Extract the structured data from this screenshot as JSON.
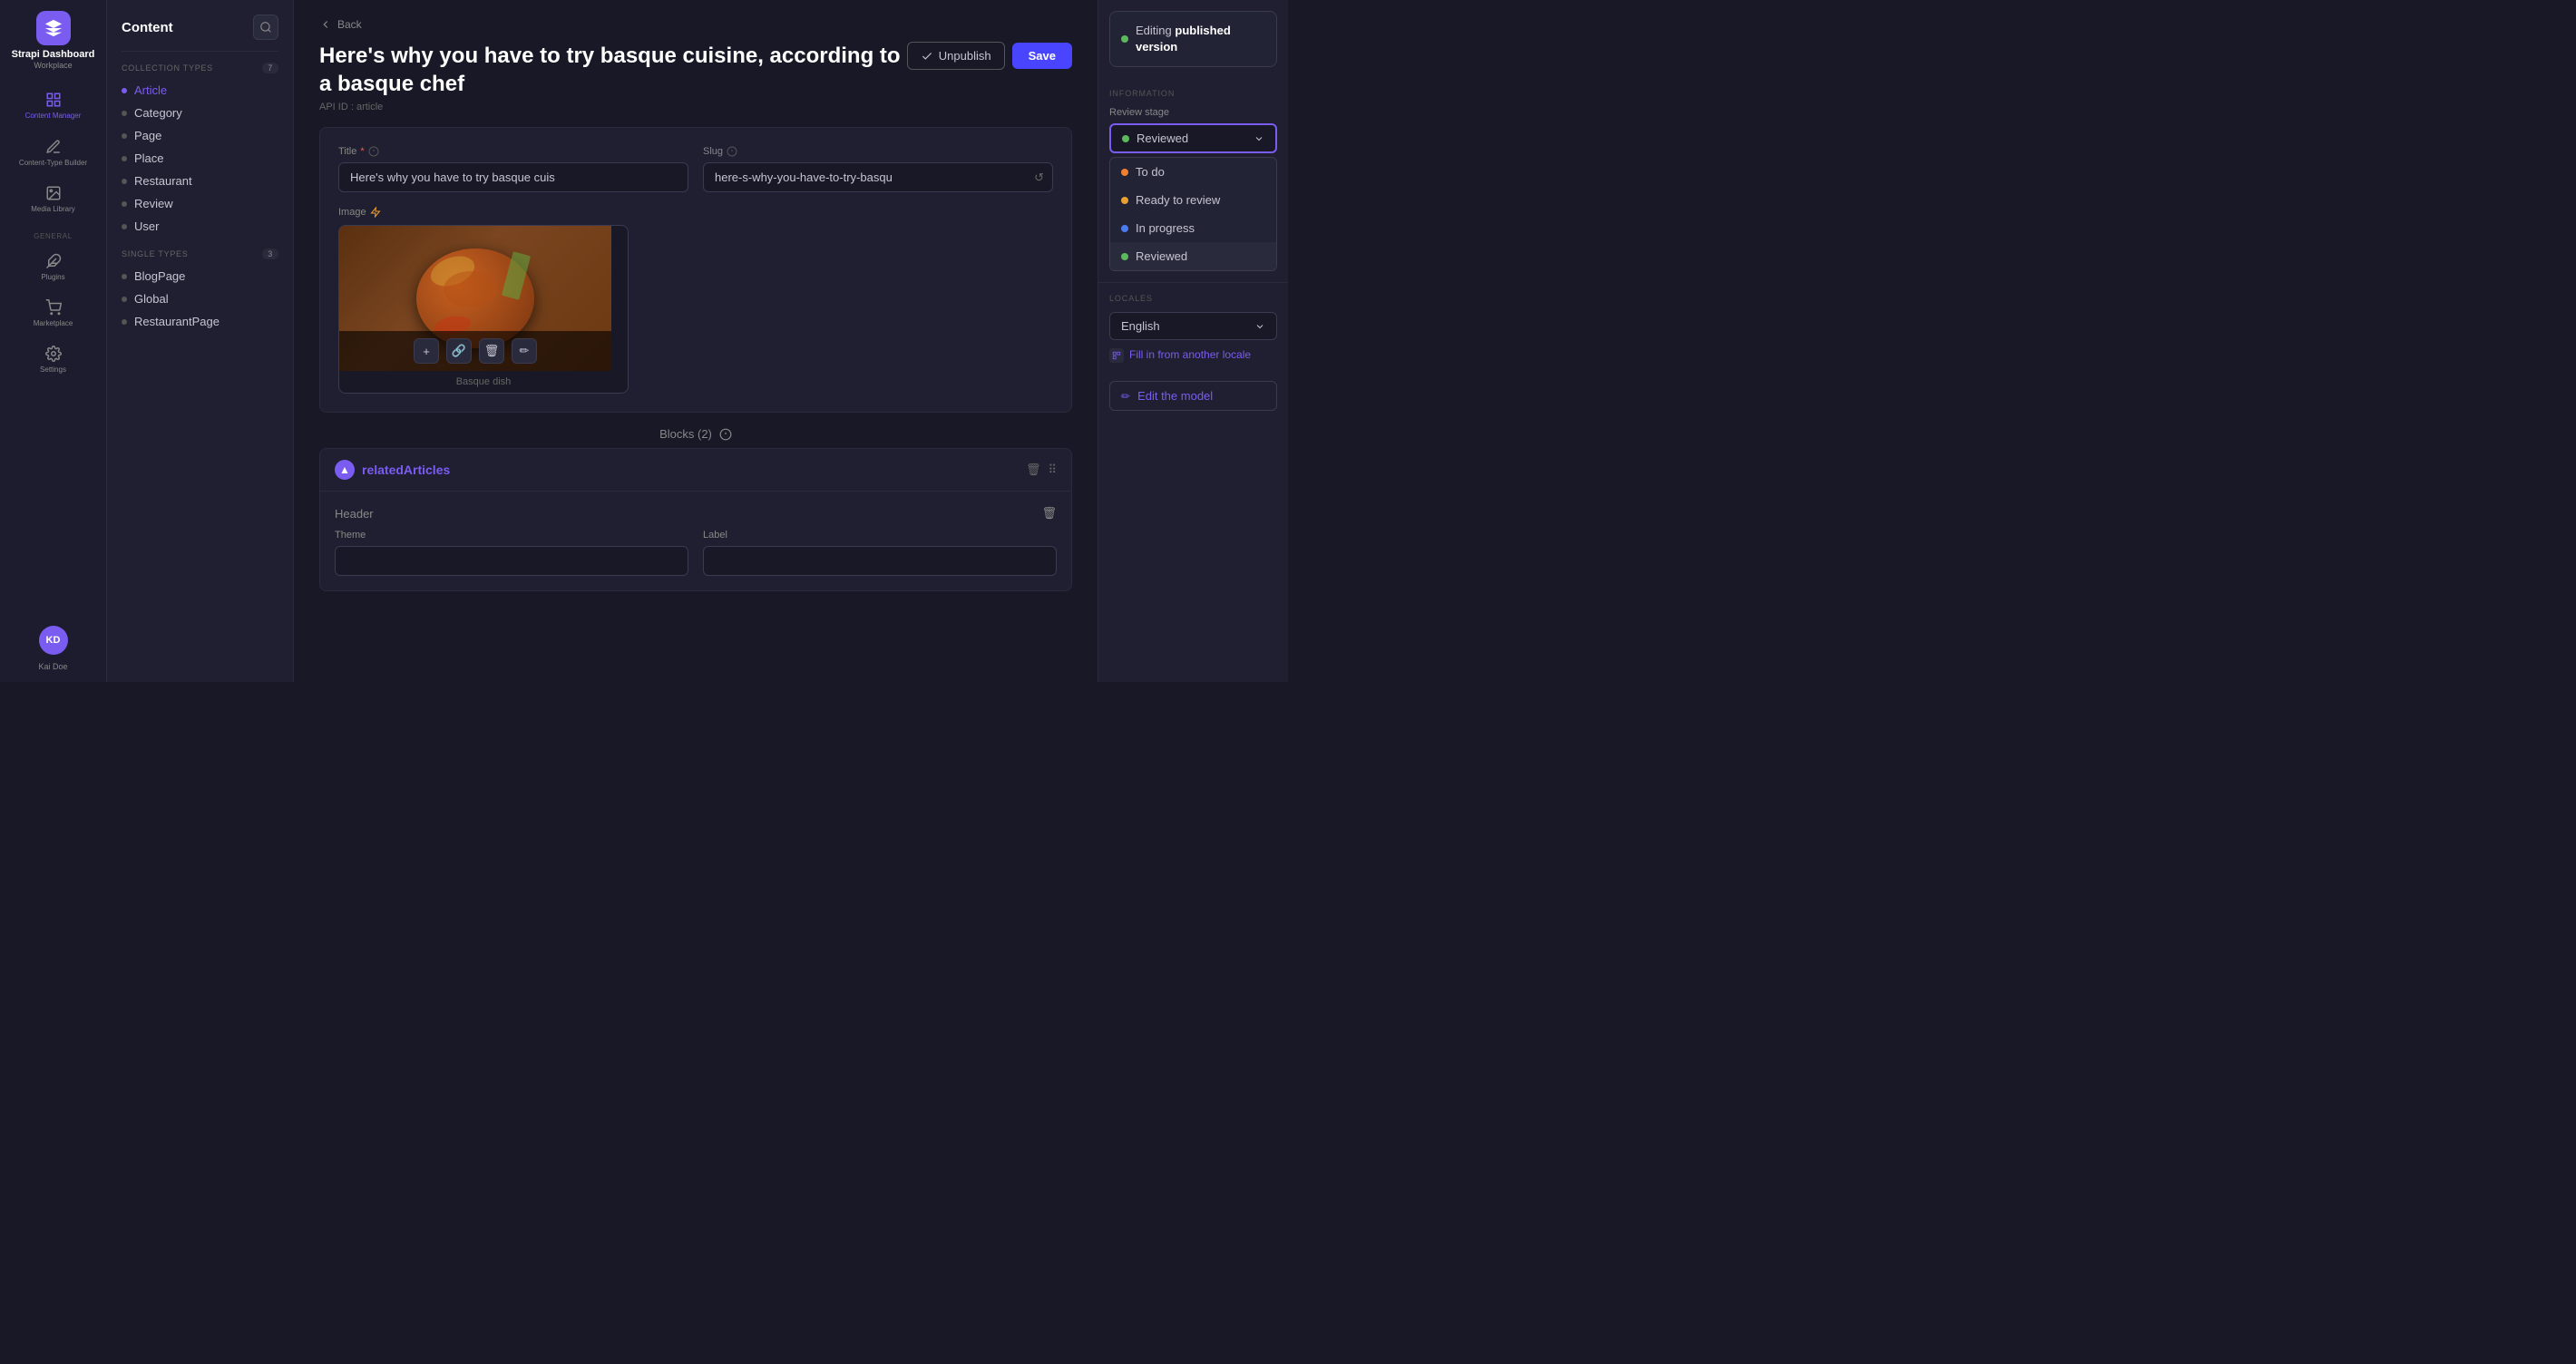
{
  "app": {
    "name": "Strapi Dashboard",
    "subtitle": "Workplace"
  },
  "sidebar": {
    "nav_items": [
      {
        "id": "content-manager",
        "label": "Content Manager",
        "active": true
      },
      {
        "id": "content-type-builder",
        "label": "Content-Type Builder"
      },
      {
        "id": "media-library",
        "label": "Media Library"
      }
    ],
    "general_label": "GENERAL",
    "general_items": [
      {
        "id": "plugins",
        "label": "Plugins"
      },
      {
        "id": "marketplace",
        "label": "Marketplace"
      },
      {
        "id": "settings",
        "label": "Settings"
      }
    ],
    "user": {
      "initials": "KD",
      "name": "Kai Doe"
    }
  },
  "content_panel": {
    "title": "Content",
    "collection_types_label": "COLLECTION TYPES",
    "collection_types_count": "7",
    "collection_items": [
      {
        "id": "article",
        "label": "Article",
        "active": true
      },
      {
        "id": "category",
        "label": "Category"
      },
      {
        "id": "page",
        "label": "Page"
      },
      {
        "id": "place",
        "label": "Place"
      },
      {
        "id": "restaurant",
        "label": "Restaurant"
      },
      {
        "id": "review",
        "label": "Review"
      },
      {
        "id": "user",
        "label": "User"
      }
    ],
    "single_types_label": "SINGLE TYPES",
    "single_types_count": "3",
    "single_items": [
      {
        "id": "blogpage",
        "label": "BlogPage"
      },
      {
        "id": "global",
        "label": "Global"
      },
      {
        "id": "restaurantpage",
        "label": "RestaurantPage"
      }
    ]
  },
  "main": {
    "back_label": "Back",
    "page_title": "Here's why you have to try basque cuisine, according to a basque chef",
    "api_id_label": "API ID : article",
    "btn_unpublish": "Unpublish",
    "btn_save": "Save",
    "form": {
      "title_label": "Title",
      "title_required": "*",
      "title_value": "Here's why you have to try basque cuis",
      "slug_label": "Slug",
      "slug_value": "here-s-why-you-have-to-try-basqu",
      "image_label": "Image",
      "image_caption": "Basque dish",
      "blocks_label": "Blocks (2)",
      "related_articles_title": "relatedArticles",
      "header_label": "Header",
      "theme_label": "Theme",
      "label_label": "Label"
    }
  },
  "right_panel": {
    "editing_label": "Editing",
    "published_label": "published version",
    "information_label": "INFORMATION",
    "review_stage_label": "Review stage",
    "review_value": "Reviewed",
    "dropdown_items": [
      {
        "id": "todo",
        "label": "To do",
        "color": "orange"
      },
      {
        "id": "ready-to-review",
        "label": "Ready to review",
        "color": "yellow"
      },
      {
        "id": "in-progress",
        "label": "In progress",
        "color": "blue"
      },
      {
        "id": "reviewed",
        "label": "Reviewed",
        "color": "green",
        "selected": true
      }
    ],
    "locales_label": "Locales",
    "locale_value": "English",
    "fill_locale_label": "Fill in from another locale",
    "edit_model_label": "Edit the model"
  }
}
